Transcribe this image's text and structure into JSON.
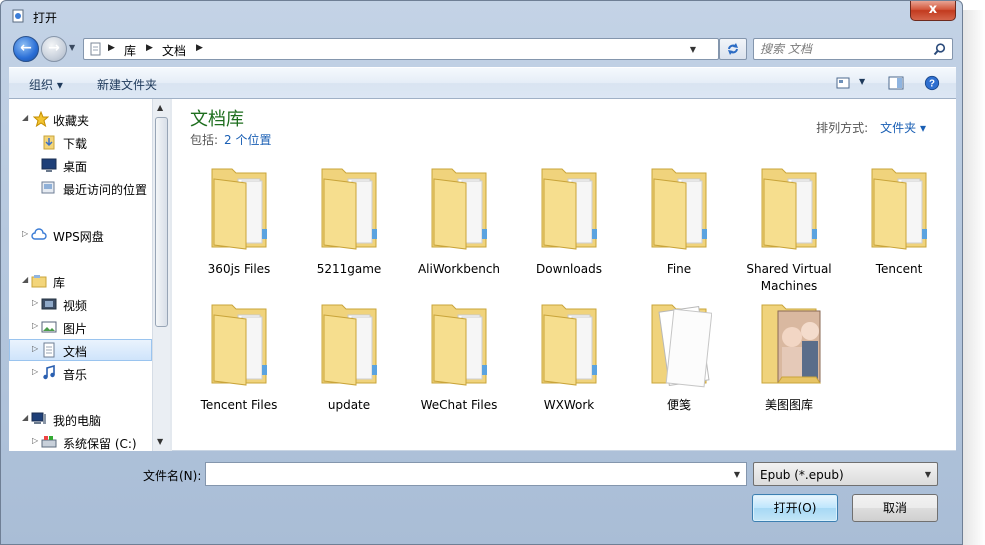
{
  "window": {
    "title": "打开",
    "close_symbol": "x"
  },
  "address_bar": {
    "crumbs": [
      "库",
      "文档"
    ],
    "search_placeholder": "搜索 文档"
  },
  "toolbar": {
    "organize_label": "组织 ▾",
    "new_folder_label": "新建文件夹"
  },
  "sidebar": {
    "favorites": "收藏夹",
    "downloads": "下载",
    "desktop": "桌面",
    "recent": "最近访问的位置",
    "wps": "WPS网盘",
    "libraries": "库",
    "videos": "视频",
    "pictures": "图片",
    "documents": "文档",
    "music": "音乐",
    "computer": "我的电脑",
    "system_drive": "系统保留 (C:)"
  },
  "library": {
    "title": "文档库",
    "includes_label": "包括:",
    "includes_link": "2 个位置",
    "arrange_label": "排列方式:",
    "arrange_value": "文件夹 ▾"
  },
  "folders": {
    "f1": "360js Files",
    "f2": "5211game",
    "f3": "AliWorkbench",
    "f4": "Downloads",
    "f5": "Fine",
    "f6": "Shared Virtual Machines",
    "f7": "Tencent",
    "f8": "Tencent Files",
    "f9": "update",
    "f10": "WeChat Files",
    "f11": "WXWork",
    "f12": "便笺",
    "f13": "美图图库"
  },
  "footer": {
    "filename_label": "文件名(N):",
    "filename_value": "",
    "filetype_value": "Epub (*.epub)",
    "open_label": "打开(O)",
    "cancel_label": "取消"
  },
  "colors": {
    "title_green": "#1e6e1e",
    "link_blue": "#1a5fb4",
    "folder_yellow": "#f3d57a"
  }
}
